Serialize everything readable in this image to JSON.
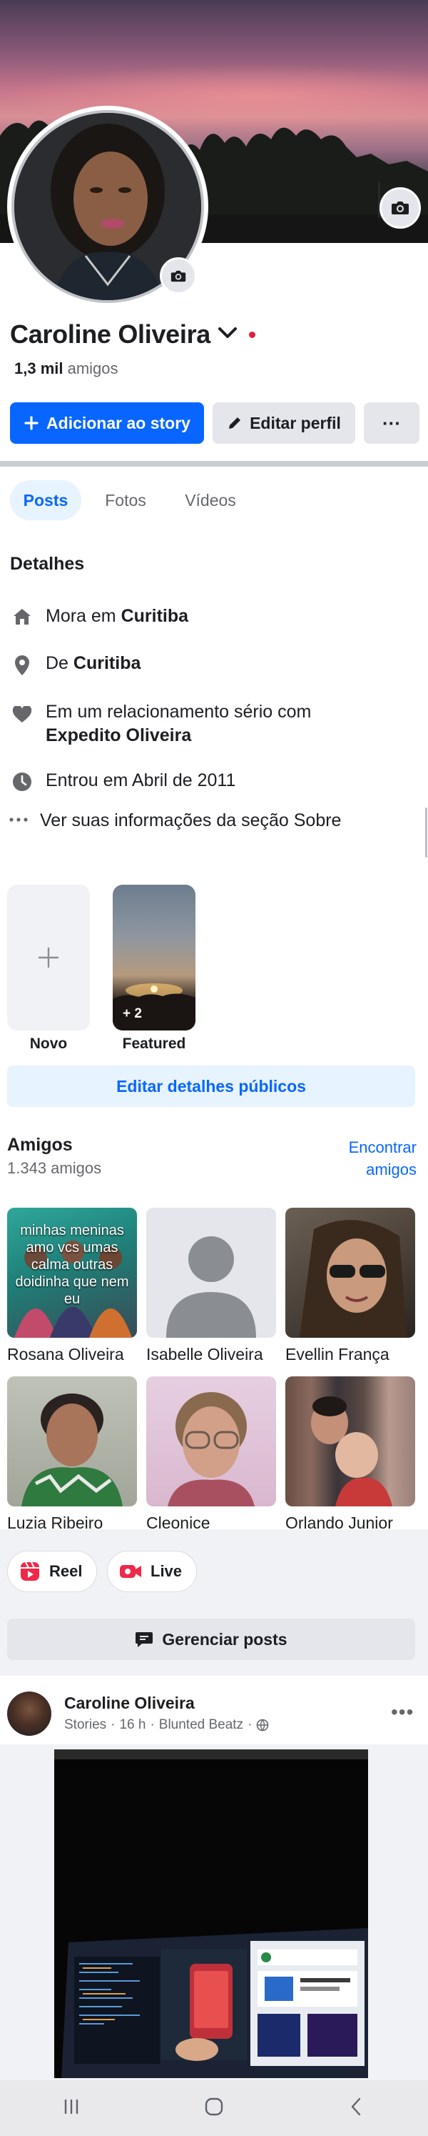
{
  "profile": {
    "name": "Caroline Oliveira",
    "friends_count_bold": "1,3 mil",
    "friends_count_label": "amigos"
  },
  "actions": {
    "add_story": "Adicionar ao story",
    "edit_profile": "Editar perfil",
    "more": "···"
  },
  "tabs": [
    {
      "label": "Posts",
      "active": true
    },
    {
      "label": "Fotos",
      "active": false
    },
    {
      "label": "Vídeos",
      "active": false
    }
  ],
  "details": {
    "title": "Detalhes",
    "lives_prefix": "Mora em",
    "lives_city": "Curitiba",
    "from_prefix": "De",
    "from_city": "Curitiba",
    "relationship_prefix": "Em um relacionamento sério com",
    "relationship_partner": "Expedito Oliveira",
    "joined": "Entrou em Abril de 2011",
    "see_about": "Ver suas informações da seção Sobre"
  },
  "highlights": {
    "new_label": "Novo",
    "featured_label": "Featured",
    "featured_count": "+ 2",
    "edit_public": "Editar detalhes públicos"
  },
  "friends": {
    "title": "Amigos",
    "count": "1.343 amigos",
    "find": "Encontrar amigos",
    "rosana_overlay": "minhas meninas amo vcs umas calma outras doidinha que nem eu",
    "list": [
      {
        "name": "Rosana Oliveira"
      },
      {
        "name": "Isabelle Oliveira"
      },
      {
        "name": "Evellin França"
      },
      {
        "name": "Luzia Ribeiro"
      },
      {
        "name": "Cleonice"
      },
      {
        "name": "Orlando Junior"
      }
    ]
  },
  "composer": {
    "reel": "Reel",
    "live": "Live",
    "manage_posts": "Gerenciar posts"
  },
  "post": {
    "author": "Caroline Oliveira",
    "source": "Stories",
    "time": "16 h",
    "audio": "Blunted Beatz"
  },
  "colors": {
    "primary": "#0866ff",
    "secondary_bg": "#e4e6eb",
    "light_blue": "#e7f3ff",
    "text": "#1c1e21",
    "muted": "#65676b",
    "online_dot": "#e41e3f"
  }
}
